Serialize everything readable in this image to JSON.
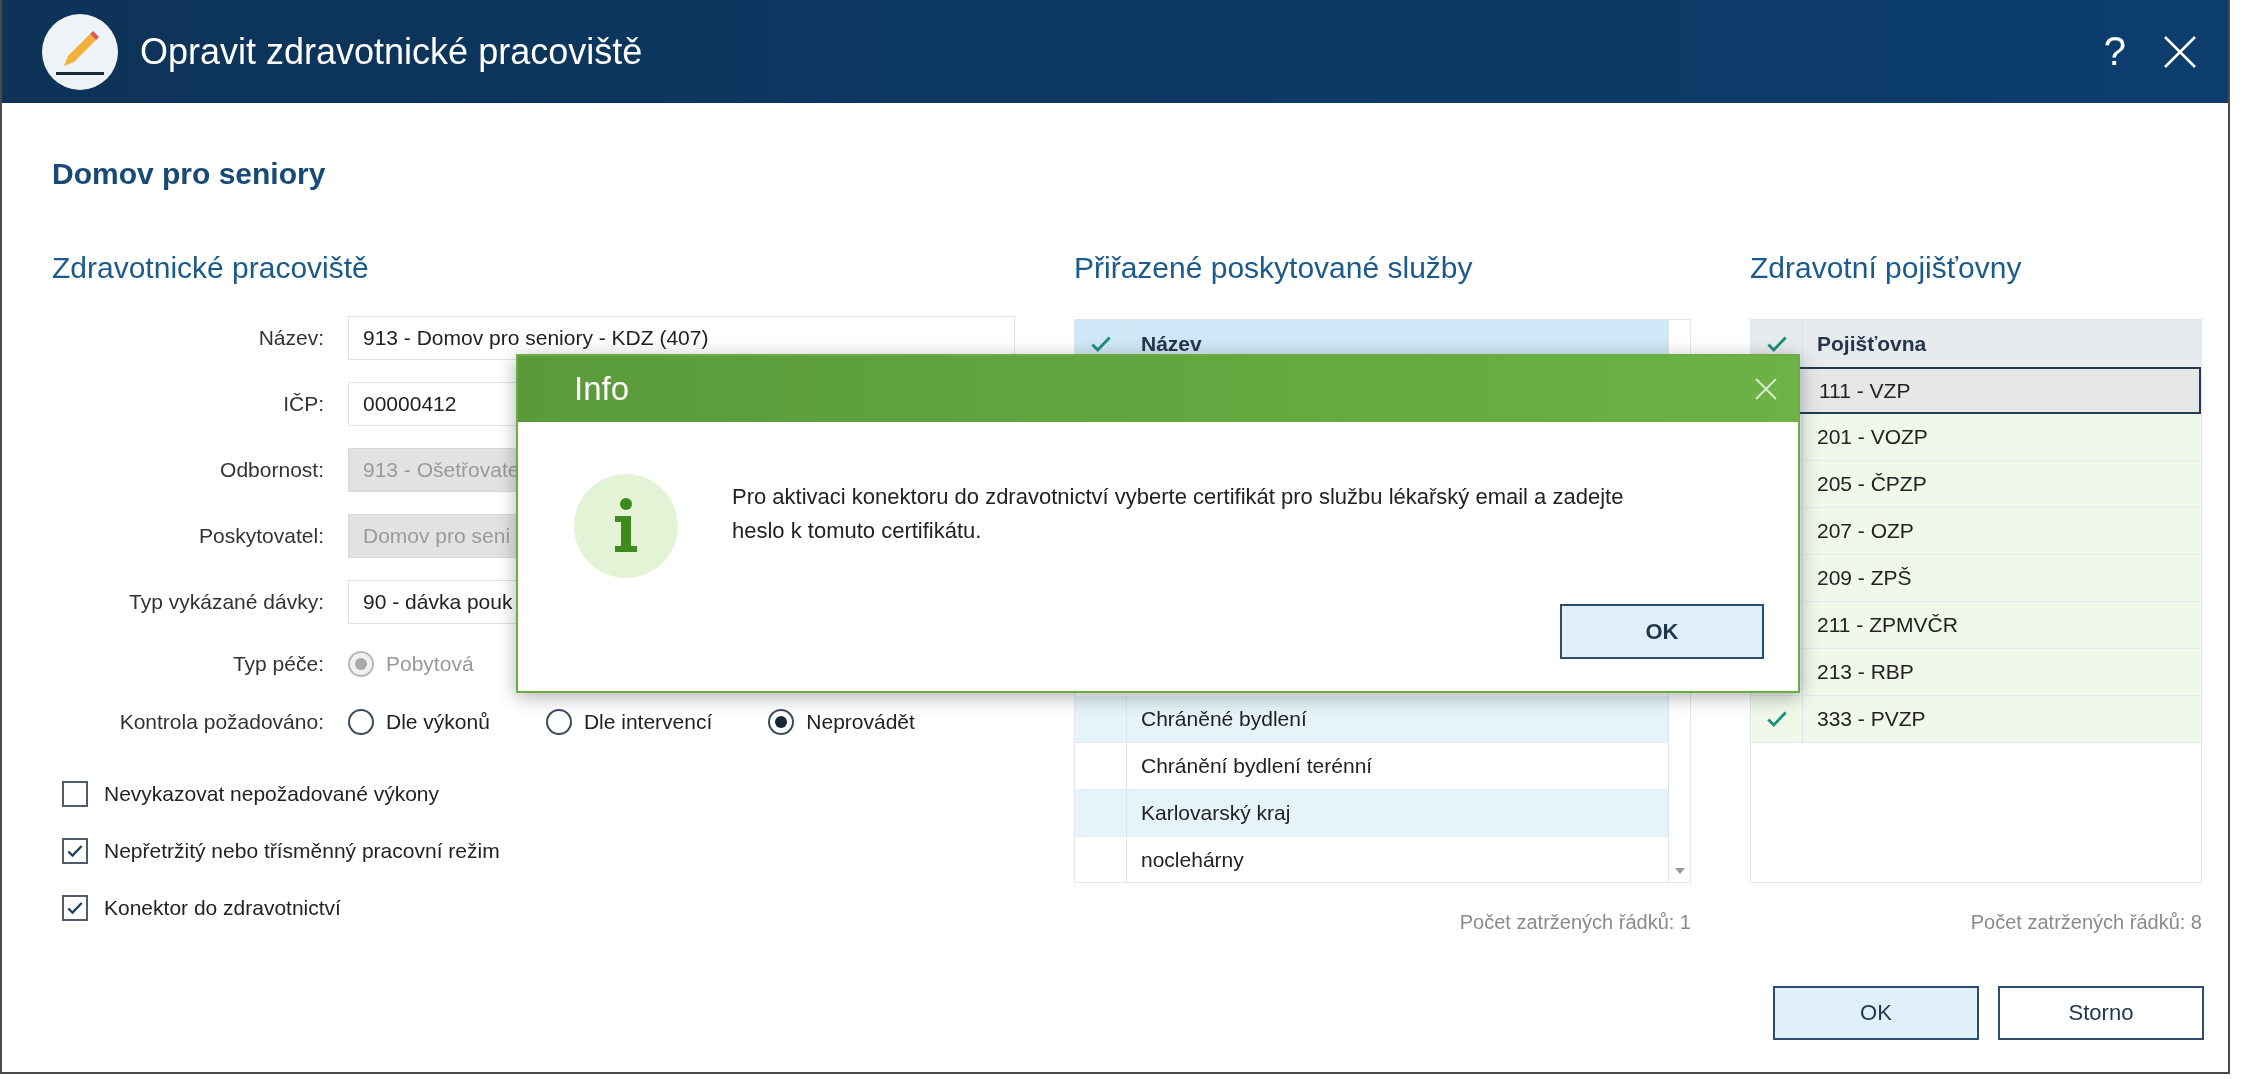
{
  "window": {
    "title": "Opravit zdravotnické pracoviště",
    "help": "?"
  },
  "heading": "Domov pro seniory",
  "workplace": {
    "title": "Zdravotnické pracoviště",
    "fields": [
      {
        "label": "Název:",
        "value": "913 - Domov pro seniory - KDZ (407)",
        "disabled": false
      },
      {
        "label": "IČP:",
        "value": "00000412",
        "disabled": false
      },
      {
        "label": "Odbornost:",
        "value": "913 - Ošetřovate",
        "disabled": true
      },
      {
        "label": "Poskytovatel:",
        "value": "Domov pro seni",
        "disabled": true
      },
      {
        "label": "Typ vykázané dávky:",
        "value": "90 - dávka pouk",
        "disabled": false
      }
    ],
    "radio_groups": [
      {
        "label": "Typ péče:",
        "options": [
          {
            "label": "Pobytová",
            "selected": true,
            "disabled": true
          }
        ]
      },
      {
        "label": "Kontrola požadováno:",
        "options": [
          {
            "label": "Dle výkonů",
            "selected": false,
            "disabled": false
          },
          {
            "label": "Dle intervencí",
            "selected": false,
            "disabled": false
          },
          {
            "label": "Neprovádět",
            "selected": true,
            "disabled": false
          }
        ]
      }
    ],
    "checkboxes": [
      {
        "label": "Nevykazovat nepožadované výkony",
        "checked": false
      },
      {
        "label": "Nepřetržitý nebo třísměnný pracovní režim",
        "checked": true
      },
      {
        "label": "Konektor do zdravotnictví",
        "checked": true
      }
    ]
  },
  "services": {
    "title": "Přiřazené poskytované služby",
    "column": "Název",
    "rows": [
      {
        "name": "Chráněné bydlení",
        "checked": false
      },
      {
        "name": "Chránění bydlení terénní",
        "checked": false
      },
      {
        "name": "Karlovarský kraj",
        "checked": false
      },
      {
        "name": "noclehárny",
        "checked": false
      }
    ],
    "count": "Počet zatržených řádků: 1"
  },
  "insurers": {
    "title": "Zdravotní pojišťovny",
    "column": "Pojišťovna",
    "rows": [
      {
        "name": "111 - VZP",
        "selected": true
      },
      {
        "name": "201 - VOZP",
        "selected": false
      },
      {
        "name": "205 - ČPZP",
        "selected": false
      },
      {
        "name": "207 - OZP",
        "selected": false
      },
      {
        "name": "209 - ZPŠ",
        "selected": false
      },
      {
        "name": "211 - ZPMVČR",
        "selected": false
      },
      {
        "name": "213 - RBP",
        "selected": false
      },
      {
        "name": "333 - PVZP",
        "checked": true,
        "selected": false
      }
    ],
    "count": "Počet zatržených řádků: 8"
  },
  "buttons": [
    {
      "label": "OK",
      "primary": true
    },
    {
      "label": "Storno",
      "primary": false
    }
  ],
  "info_dialog": {
    "title": "Info",
    "message": "Pro aktivaci konektoru do zdravotnictví vyberte certifikát pro službu lékařský email a zadejte heslo k tomuto certifikátu.",
    "button": "OK"
  }
}
